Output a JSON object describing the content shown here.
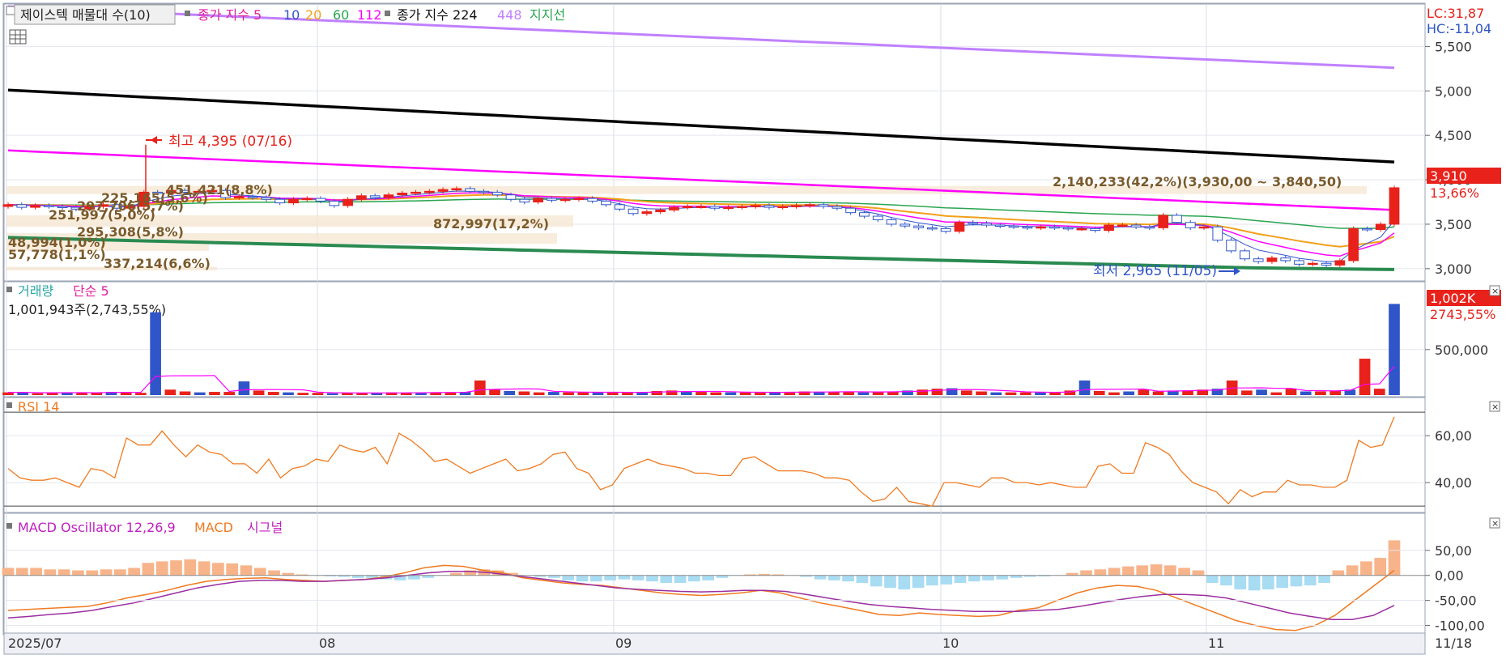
{
  "header": {
    "title": "제이스텍 매물대 수(10)",
    "legend_prefix": "종가 지수 5",
    "legend_10": "10",
    "legend_20": "20",
    "legend_60": "60",
    "legend_112": "112",
    "legend_224": "종가 지수 224",
    "legend_448": "448",
    "legend_support": "지지선",
    "lc": "LC:31,87",
    "hc": "HC:-11,04"
  },
  "price_panel": {
    "high_label": "최고 4,395 (07/16)",
    "low_label": "최저 2,965 (11/05)",
    "last_price": "3,910",
    "last_change": "13,66%",
    "y_ticks": [
      "5,500",
      "5,000",
      "4,500",
      "4,000",
      "3,500",
      "3,000"
    ],
    "volume_profile_labels": [
      "2,140,233(42,2%)(3,930,00 ~ 3,840,50)",
      "872,997(17,2%)",
      "251,997(5,0%)",
      "295,308(5,8%)",
      "48,994(1,0%)",
      "57,778(1,1%)",
      "337,214(6,6%)",
      "225,165(5,6%)",
      "451,421(8,8%)",
      "297,706(5,7%)"
    ]
  },
  "volume_panel": {
    "title": "거래량",
    "ma_label": "단순 5",
    "info": "1,001,943주(2,743,55%)",
    "last_value": "1,002K",
    "last_pct": "2743,55%",
    "y_ticks": [
      "500,000"
    ]
  },
  "rsi_panel": {
    "title": "RSI 14",
    "y_ticks": [
      "60,00",
      "40,00"
    ]
  },
  "macd_panel": {
    "title": "MACD Oscillator 12,26,9",
    "macd_label": "MACD",
    "signal_label": "시그널",
    "y_ticks": [
      "50,00",
      "0,00",
      "-50,00",
      "-100,00"
    ]
  },
  "x_axis": {
    "labels": [
      "2025/07",
      "08",
      "09",
      "10",
      "11"
    ],
    "last_date": "11/18"
  },
  "colors": {
    "up": "#e8211a",
    "down": "#2f55c8",
    "ma5": "#3355cc",
    "ma10": "#ff00ff",
    "ma20": "#f2a01a",
    "ma60": "#2aa550",
    "ma112": "#ff00ff",
    "ma224": "#000000",
    "ma448": "#c080ff",
    "support": "#2a8a50",
    "rsi": "#f07a20",
    "macd": "#f07a20",
    "signal": "#9b2fa0",
    "osc_pos": "#f7b48a",
    "osc_neg": "#a8dcf3"
  },
  "chart_data": [
    {
      "type": "candlestick",
      "title": "제이스텍 매물대 수(10)",
      "x": [
        "2025/07",
        "08",
        "09",
        "10",
        "11",
        "11/18"
      ],
      "ylim": [
        2880,
        5950
      ],
      "last_close": 3910,
      "high": {
        "value": 4395,
        "date": "07/16"
      },
      "low": {
        "value": 2965,
        "date": "11/05"
      },
      "closes": [
        3720,
        3690,
        3710,
        3700,
        3690,
        3670,
        3700,
        3720,
        3680,
        3700,
        3860,
        3850,
        3880,
        3860,
        3870,
        3880,
        3800,
        3810,
        3800,
        3780,
        3740,
        3780,
        3790,
        3760,
        3710,
        3780,
        3820,
        3800,
        3830,
        3850,
        3860,
        3870,
        3890,
        3900,
        3870,
        3860,
        3830,
        3780,
        3750,
        3790,
        3770,
        3780,
        3790,
        3760,
        3720,
        3670,
        3620,
        3640,
        3660,
        3690,
        3700,
        3700,
        3680,
        3690,
        3700,
        3710,
        3690,
        3700,
        3710,
        3720,
        3700,
        3680,
        3630,
        3590,
        3550,
        3500,
        3480,
        3460,
        3450,
        3420,
        3520,
        3510,
        3490,
        3480,
        3470,
        3460,
        3470,
        3460,
        3450,
        3450,
        3430,
        3490,
        3490,
        3470,
        3460,
        3600,
        3520,
        3460,
        3470,
        3320,
        3200,
        3110,
        3080,
        3120,
        3090,
        3050,
        3060,
        3040,
        3090,
        3450,
        3440,
        3500,
        3910
      ],
      "ma224": {
        "start": 5010,
        "end": 4200
      },
      "ma448": {
        "start": 5950,
        "end": 5260
      },
      "ma112": {
        "start": 4330,
        "end": 3660
      },
      "support": {
        "start": 3350,
        "end": 2970
      }
    },
    {
      "type": "bar",
      "title": "거래량",
      "series_name": "거래량",
      "ylim": [
        0,
        1050000
      ],
      "last_value": 1001943,
      "values": [
        30000,
        30000,
        20000,
        25000,
        30000,
        30000,
        25000,
        35000,
        30000,
        25000,
        910000,
        60000,
        40000,
        30000,
        35000,
        35000,
        150000,
        50000,
        35000,
        30000,
        25000,
        25000,
        20000,
        25000,
        20000,
        25000,
        30000,
        25000,
        30000,
        30000,
        30000,
        35000,
        160000,
        60000,
        45000,
        40000,
        30000,
        35000,
        30000,
        30000,
        30000,
        30000,
        30000,
        30000,
        45000,
        50000,
        40000,
        35000,
        30000,
        30000,
        30000,
        30000,
        30000,
        35000,
        40000,
        35000,
        35000,
        40000,
        30000,
        35000,
        40000,
        50000,
        60000,
        70000,
        75000,
        50000,
        40000,
        30000,
        30000,
        30000,
        30000,
        30000,
        50000,
        160000,
        45000,
        30000,
        40000,
        60000,
        40000,
        50000,
        50000,
        60000,
        70000,
        160000,
        50000,
        60000,
        30000,
        70000,
        40000,
        40000,
        50000,
        60000,
        400000,
        70000,
        1001943
      ]
    },
    {
      "type": "line",
      "title": "RSI 14",
      "ylim": [
        29,
        69
      ],
      "values": [
        46,
        42,
        41,
        41,
        42,
        40,
        38,
        46,
        45,
        42,
        59,
        56,
        56,
        62,
        56,
        51,
        56,
        53,
        52,
        48,
        48,
        44,
        50,
        42,
        46,
        47,
        50,
        49,
        56,
        54,
        53,
        55,
        48,
        61,
        58,
        54,
        49,
        50,
        47,
        44,
        46,
        48,
        50,
        45,
        46,
        48,
        52,
        53,
        46,
        44,
        37,
        39,
        46,
        48,
        50,
        48,
        47,
        46,
        44,
        44,
        43,
        43,
        50,
        51,
        48,
        45,
        45,
        45,
        44,
        42,
        42,
        41,
        36,
        32,
        33,
        38,
        32,
        31,
        30,
        40,
        40,
        39,
        38,
        42,
        42,
        40,
        40,
        39,
        40,
        39,
        38,
        38,
        47,
        48,
        44,
        44,
        57,
        55,
        52,
        45,
        40,
        38,
        36,
        31,
        37,
        34,
        36,
        36,
        41,
        39,
        39,
        38,
        38,
        41,
        58,
        55,
        56,
        68
      ]
    },
    {
      "type": "bar",
      "title": "MACD Oscillator 12,26,9",
      "ylim": [
        -112,
        82
      ],
      "oscillator": [
        15,
        15,
        15,
        12,
        12,
        10,
        10,
        12,
        12,
        15,
        25,
        28,
        30,
        32,
        28,
        25,
        24,
        20,
        15,
        10,
        5,
        2,
        0,
        -2,
        -3,
        -5,
        -5,
        -8,
        -10,
        -8,
        -5,
        0,
        5,
        10,
        12,
        10,
        5,
        0,
        -3,
        -5,
        -10,
        -12,
        -12,
        -10,
        -8,
        -10,
        -12,
        -15,
        -15,
        -12,
        -10,
        -5,
        0,
        2,
        3,
        2,
        0,
        -3,
        -8,
        -10,
        -12,
        -15,
        -22,
        -25,
        -28,
        -25,
        -20,
        -18,
        -15,
        -12,
        -10,
        -8,
        -5,
        -3,
        -2,
        0,
        5,
        10,
        12,
        15,
        18,
        20,
        22,
        20,
        15,
        10,
        -15,
        -20,
        -28,
        -30,
        -28,
        -25,
        -22,
        -20,
        -15,
        10,
        20,
        28,
        35,
        70
      ],
      "macd": [
        -70,
        -68,
        -66,
        -64,
        -62,
        -55,
        -45,
        -38,
        -30,
        -20,
        -12,
        -8,
        -6,
        -5,
        -8,
        -10,
        -12,
        -10,
        -8,
        -3,
        5,
        15,
        20,
        18,
        10,
        5,
        -5,
        -10,
        -15,
        -18,
        -20,
        -25,
        -30,
        -35,
        -38,
        -40,
        -38,
        -35,
        -30,
        -35,
        -45,
        -55,
        -62,
        -70,
        -78,
        -80,
        -75,
        -78,
        -80,
        -82,
        -80,
        -70,
        -65,
        -50,
        -35,
        -25,
        -20,
        -22,
        -30,
        -45,
        -60,
        -75,
        -90,
        -100,
        -108,
        -110,
        -100,
        -80,
        -50,
        -20,
        10
      ],
      "signal": [
        -85,
        -82,
        -78,
        -75,
        -70,
        -62,
        -55,
        -45,
        -35,
        -25,
        -18,
        -12,
        -10,
        -10,
        -12,
        -12,
        -10,
        -8,
        -5,
        0,
        5,
        8,
        8,
        5,
        0,
        -5,
        -10,
        -15,
        -20,
        -25,
        -28,
        -30,
        -32,
        -33,
        -32,
        -30,
        -30,
        -32,
        -38,
        -45,
        -52,
        -58,
        -62,
        -65,
        -68,
        -70,
        -72,
        -72,
        -72,
        -70,
        -68,
        -62,
        -55,
        -48,
        -42,
        -38,
        -38,
        -40,
        -45,
        -55,
        -65,
        -75,
        -82,
        -88,
        -88,
        -80,
        -60
      ]
    }
  ]
}
